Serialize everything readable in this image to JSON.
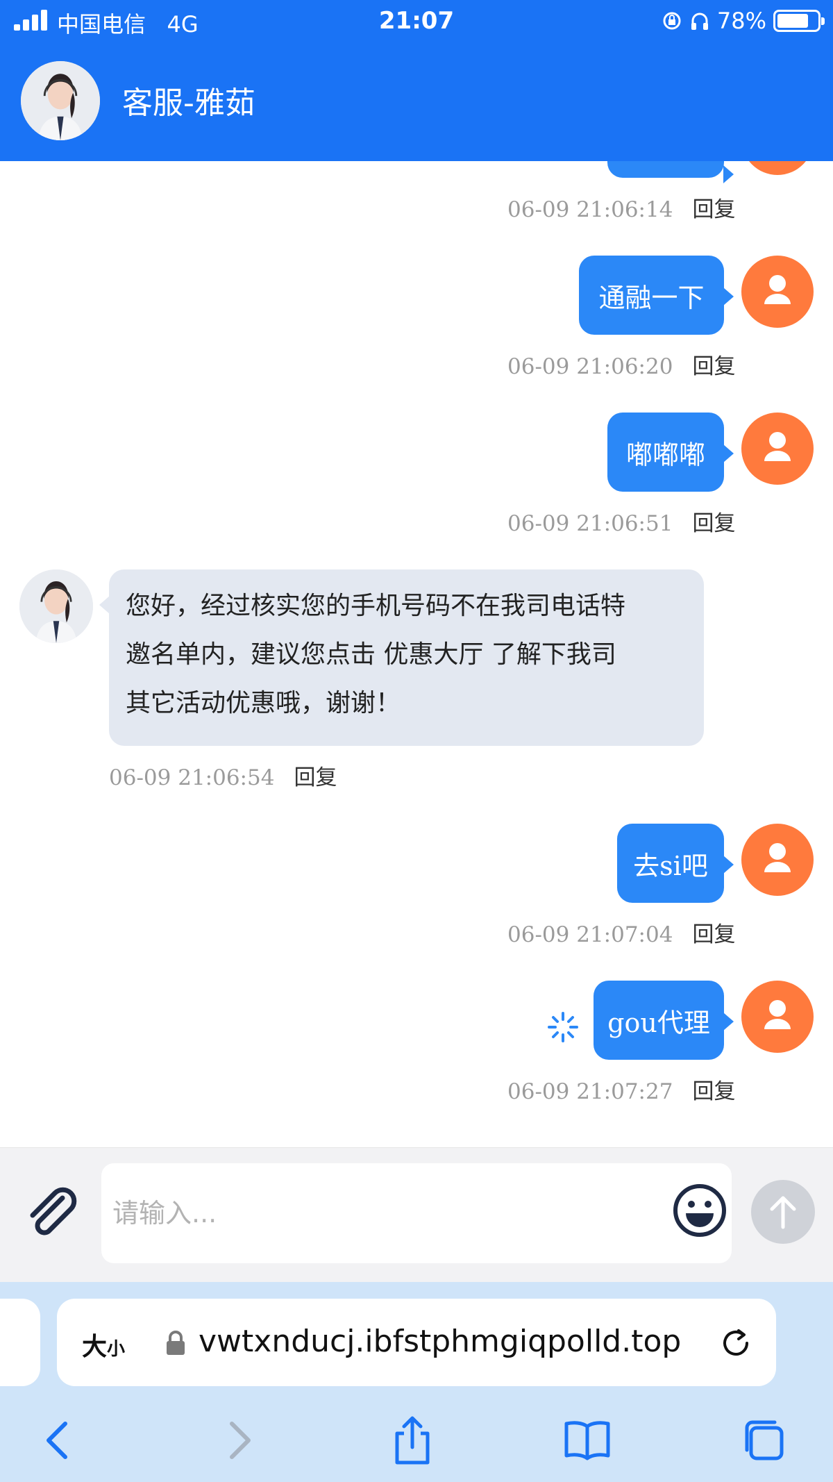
{
  "status_bar": {
    "carrier": "中国电信",
    "network": "4G",
    "time": "21:07",
    "battery": "78%",
    "battery_level": 0.78
  },
  "header": {
    "agent_name": "客服-雅茹"
  },
  "messages": [
    {
      "text": "通融一下",
      "timestamp": "06-09 21:06:20",
      "reply": "回复"
    },
    {
      "text": "嘟嘟嘟",
      "timestamp": "06-09 21:06:51",
      "reply": "回复"
    },
    {
      "lines": [
        "您好，经过核实您的手机号码不在我司电话特",
        "邀名单内，建议您点击 优惠大厅 了解下我司",
        "其它活动优惠哦，谢谢！"
      ],
      "timestamp": "06-09 21:06:54",
      "reply": "回复"
    },
    {
      "text": "去si吧",
      "timestamp": "06-09 21:07:04",
      "reply": "回复"
    },
    {
      "text": "gou代理",
      "timestamp": "06-09 21:07:27",
      "reply": "回复"
    }
  ],
  "top_meta": {
    "timestamp": "06-09 21:06:14",
    "reply": "回复"
  },
  "input": {
    "placeholder": "请输入..."
  },
  "browser": {
    "text_size_big": "大",
    "text_size_small": "小",
    "url": "vwtxnducj.ibfstphmgiqpolld.top"
  },
  "colors": {
    "header": "#1a73f5",
    "outgoing_bubble": "#2b88f7",
    "incoming_bubble": "#e3e8f1",
    "user_avatar": "#ff7a3d",
    "browser_bar": "#cfe4f9"
  }
}
